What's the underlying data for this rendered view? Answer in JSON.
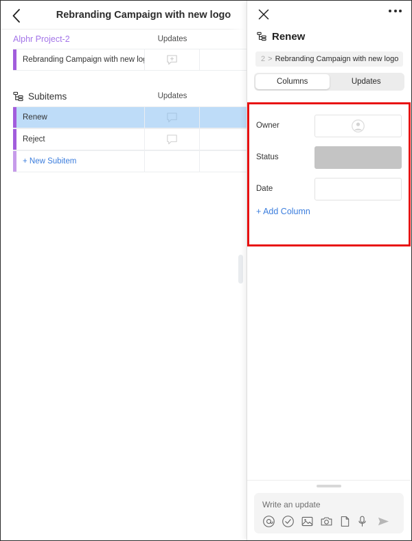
{
  "left": {
    "topbar": {
      "back_icon": "chevron-left-icon",
      "title": "Rebranding Campaign with new logo"
    },
    "board": {
      "name": "Alphr Project-2",
      "columns": [
        "Updates"
      ],
      "rows": [
        {
          "name": "Rebranding Campaign with new logo",
          "updates_icon": "add-update-bubble-icon"
        }
      ]
    },
    "subitems": {
      "icon": "subitems-hierarchy-icon",
      "title": "Subitems",
      "columns": [
        "Updates"
      ],
      "rows": [
        {
          "name": "Renew",
          "selected": true,
          "updates_icon": "update-bubble-icon"
        },
        {
          "name": "Reject",
          "selected": false,
          "updates_icon": "update-bubble-icon"
        }
      ],
      "new_subitem_label": "+ New Subitem"
    }
  },
  "panel": {
    "close_icon": "close-x-icon",
    "more_icon": "more-options-icon",
    "title_icon": "subitems-hierarchy-icon",
    "title": "Renew",
    "breadcrumb": {
      "number": "2",
      "separator": ">",
      "parent": "Rebranding Campaign with new logo"
    },
    "tabs": [
      {
        "label": "Columns",
        "active": true
      },
      {
        "label": "Updates",
        "active": false
      }
    ],
    "columns": {
      "highlight_color": "#e8100f",
      "fields": [
        {
          "label": "Owner",
          "value": "",
          "type": "person",
          "icon": "person-avatar-icon"
        },
        {
          "label": "Status",
          "value": "",
          "type": "status",
          "color": "#c4c4c4"
        },
        {
          "label": "Date",
          "value": "",
          "type": "date"
        }
      ],
      "add_column_label": "+ Add Column"
    },
    "composer": {
      "placeholder": "Write an update",
      "icons": [
        "mention-at-icon",
        "checkmark-circle-icon",
        "image-icon",
        "camera-icon",
        "file-icon",
        "microphone-icon"
      ],
      "send_icon": "send-arrow-icon"
    }
  },
  "theme": {
    "accent_purple": "#a25ddc",
    "board_name_color": "#a374e8",
    "link_blue": "#3b7ddd",
    "selected_row": "#bedcf8"
  }
}
